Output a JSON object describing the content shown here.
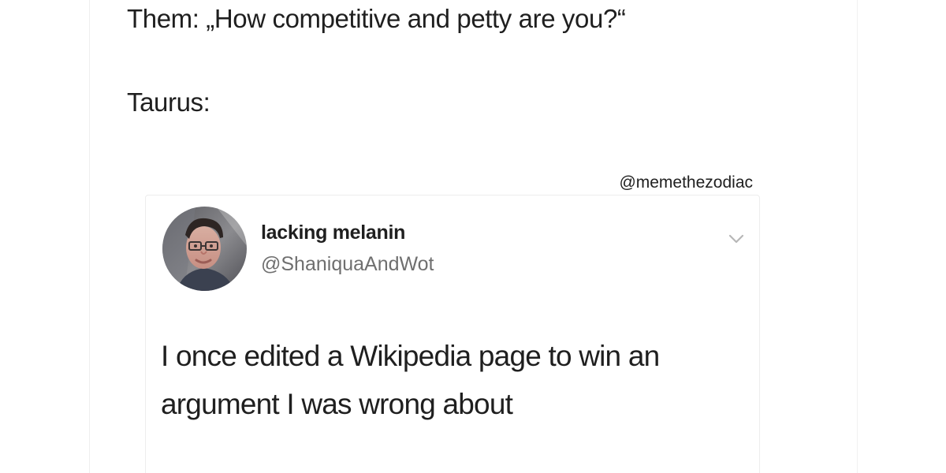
{
  "meme": {
    "line_1": "Them: „How competitive and petty are you?“",
    "line_2": "Taurus:"
  },
  "watermark": "@memethezodiac",
  "tweet": {
    "user": {
      "name": "lacking melanin",
      "handle": "@ShaniquaAndWot"
    },
    "menu_icon": "chevron-down-icon",
    "body": "I once edited a Wikipedia page to win an argument I was wrong about"
  },
  "colors": {
    "text": "#1f1f1f",
    "handle": "#6f6f6f",
    "card_border": "#ededed",
    "chevron": "#b7b7b7"
  }
}
